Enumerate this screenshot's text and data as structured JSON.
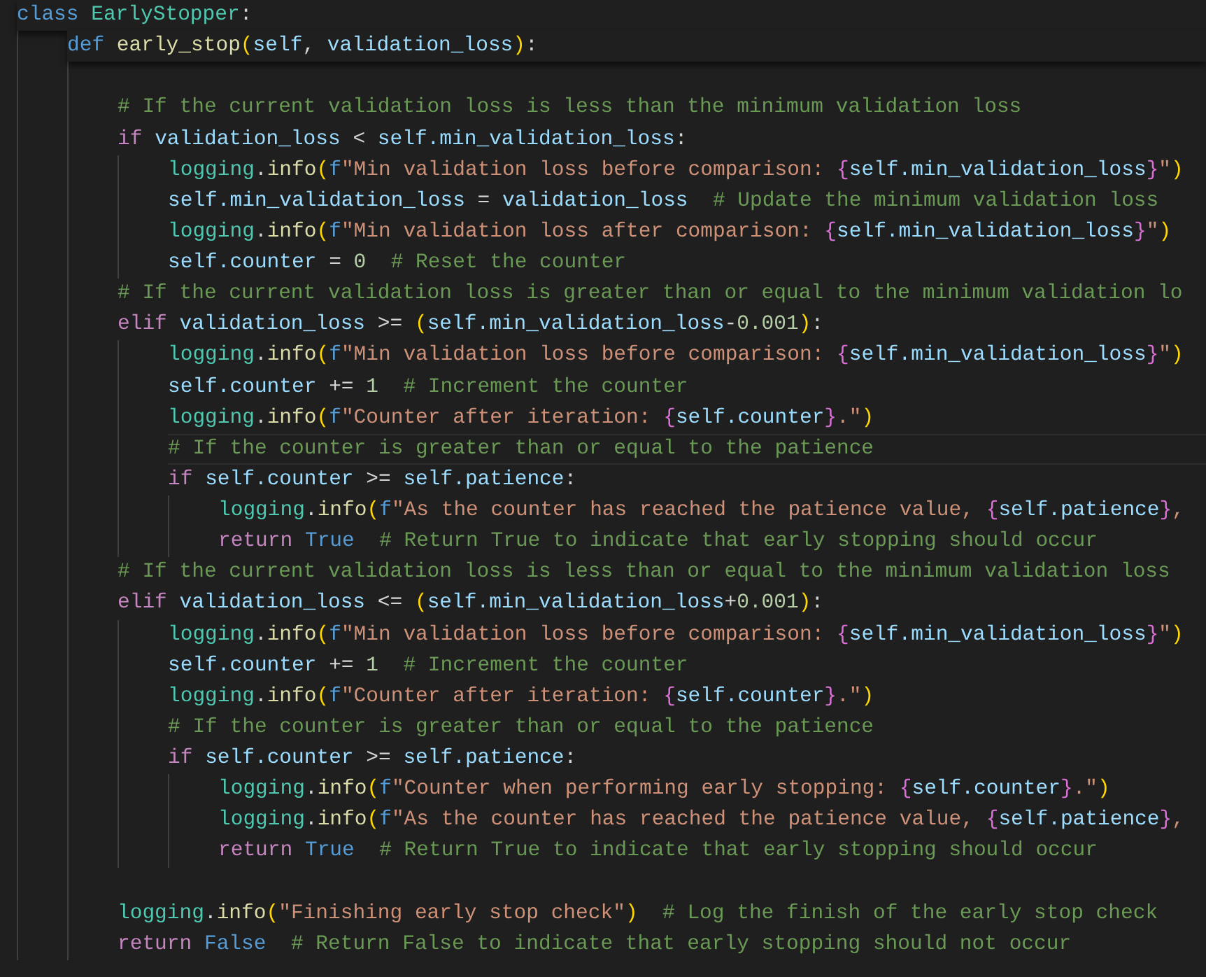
{
  "editor": {
    "lines": [
      {
        "kind": "code",
        "current": false,
        "sticky": true,
        "tokens": [
          {
            "text": "class ",
            "kind": "kw"
          },
          {
            "text": "EarlyStopper",
            "kind": "cls"
          },
          {
            "text": ":",
            "kind": "p"
          }
        ],
        "children": [
          {
            "kind": "code",
            "current": false,
            "sticky": true,
            "tokens": [
              {
                "text": "def ",
                "kind": "kw"
              },
              {
                "text": "early_stop",
                "kind": "fn"
              },
              {
                "text": "(",
                "kind": "b1"
              },
              {
                "text": "self",
                "kind": "var"
              },
              {
                "text": ", ",
                "kind": "p"
              },
              {
                "text": "validation_loss",
                "kind": "var"
              },
              {
                "text": ")",
                "kind": "b1"
              },
              {
                "text": ":",
                "kind": "p"
              }
            ],
            "children": [
              {
                "kind": "blank"
              },
              {
                "kind": "code",
                "current": false,
                "tokens": [
                  {
                    "text": "# If the current validation loss is less than the minimum validation loss",
                    "kind": "cm"
                  }
                ]
              },
              {
                "kind": "code",
                "current": false,
                "tokens": [
                  {
                    "text": "if ",
                    "kind": "ctl"
                  },
                  {
                    "text": "validation_loss",
                    "kind": "var"
                  },
                  {
                    "text": " < ",
                    "kind": "p"
                  },
                  {
                    "text": "self.min_validation_loss",
                    "kind": "var"
                  },
                  {
                    "text": ":",
                    "kind": "p"
                  }
                ],
                "children": [
                  {
                    "kind": "code",
                    "current": false,
                    "tokens": [
                      {
                        "text": "logging",
                        "kind": "cls"
                      },
                      {
                        "text": ".",
                        "kind": "p"
                      },
                      {
                        "text": "info",
                        "kind": "fn"
                      },
                      {
                        "text": "(",
                        "kind": "b1"
                      },
                      {
                        "text": "f",
                        "kind": "kw"
                      },
                      {
                        "text": "\"Min validation loss before comparison: ",
                        "kind": "str"
                      },
                      {
                        "text": "{",
                        "kind": "b2"
                      },
                      {
                        "text": "self.min_validation_loss",
                        "kind": "var"
                      },
                      {
                        "text": "}",
                        "kind": "b2"
                      },
                      {
                        "text": "\"",
                        "kind": "str"
                      },
                      {
                        "text": ")",
                        "kind": "b1"
                      }
                    ]
                  },
                  {
                    "kind": "code",
                    "current": false,
                    "tokens": [
                      {
                        "text": "self.min_validation_loss",
                        "kind": "var"
                      },
                      {
                        "text": " = ",
                        "kind": "p"
                      },
                      {
                        "text": "validation_loss  ",
                        "kind": "var"
                      },
                      {
                        "text": "# Update the minimum validation loss",
                        "kind": "cm"
                      }
                    ]
                  },
                  {
                    "kind": "code",
                    "current": false,
                    "tokens": [
                      {
                        "text": "logging",
                        "kind": "cls"
                      },
                      {
                        "text": ".",
                        "kind": "p"
                      },
                      {
                        "text": "info",
                        "kind": "fn"
                      },
                      {
                        "text": "(",
                        "kind": "b1"
                      },
                      {
                        "text": "f",
                        "kind": "kw"
                      },
                      {
                        "text": "\"Min validation loss after comparison: ",
                        "kind": "str"
                      },
                      {
                        "text": "{",
                        "kind": "b2"
                      },
                      {
                        "text": "self.min_validation_loss",
                        "kind": "var"
                      },
                      {
                        "text": "}",
                        "kind": "b2"
                      },
                      {
                        "text": "\"",
                        "kind": "str"
                      },
                      {
                        "text": ")",
                        "kind": "b1"
                      }
                    ]
                  },
                  {
                    "kind": "code",
                    "current": false,
                    "tokens": [
                      {
                        "text": "self.counter",
                        "kind": "var"
                      },
                      {
                        "text": " = ",
                        "kind": "p"
                      },
                      {
                        "text": "0  ",
                        "kind": "num"
                      },
                      {
                        "text": "# Reset the counter",
                        "kind": "cm"
                      }
                    ]
                  }
                ]
              },
              {
                "kind": "code",
                "current": false,
                "tokens": [
                  {
                    "text": "# If the current validation loss is greater than or equal to the minimum validation lo",
                    "kind": "cm"
                  }
                ]
              },
              {
                "kind": "code",
                "current": false,
                "tokens": [
                  {
                    "text": "elif ",
                    "kind": "ctl"
                  },
                  {
                    "text": "validation_loss",
                    "kind": "var"
                  },
                  {
                    "text": " >= ",
                    "kind": "p"
                  },
                  {
                    "text": "(",
                    "kind": "b1"
                  },
                  {
                    "text": "self.min_validation_loss",
                    "kind": "var"
                  },
                  {
                    "text": "-",
                    "kind": "p"
                  },
                  {
                    "text": "0.001",
                    "kind": "num"
                  },
                  {
                    "text": ")",
                    "kind": "b1"
                  },
                  {
                    "text": ":",
                    "kind": "p"
                  }
                ],
                "children": [
                  {
                    "kind": "code",
                    "current": false,
                    "tokens": [
                      {
                        "text": "logging",
                        "kind": "cls"
                      },
                      {
                        "text": ".",
                        "kind": "p"
                      },
                      {
                        "text": "info",
                        "kind": "fn"
                      },
                      {
                        "text": "(",
                        "kind": "b1"
                      },
                      {
                        "text": "f",
                        "kind": "kw"
                      },
                      {
                        "text": "\"Min validation loss before comparison: ",
                        "kind": "str"
                      },
                      {
                        "text": "{",
                        "kind": "b2"
                      },
                      {
                        "text": "self.min_validation_loss",
                        "kind": "var"
                      },
                      {
                        "text": "}",
                        "kind": "b2"
                      },
                      {
                        "text": "\"",
                        "kind": "str"
                      },
                      {
                        "text": ")",
                        "kind": "b1"
                      }
                    ]
                  },
                  {
                    "kind": "code",
                    "current": false,
                    "tokens": [
                      {
                        "text": "self.counter",
                        "kind": "var"
                      },
                      {
                        "text": " += ",
                        "kind": "p"
                      },
                      {
                        "text": "1  ",
                        "kind": "num"
                      },
                      {
                        "text": "# Increment the counter",
                        "kind": "cm"
                      }
                    ]
                  },
                  {
                    "kind": "code",
                    "current": false,
                    "tokens": [
                      {
                        "text": "logging",
                        "kind": "cls"
                      },
                      {
                        "text": ".",
                        "kind": "p"
                      },
                      {
                        "text": "info",
                        "kind": "fn"
                      },
                      {
                        "text": "(",
                        "kind": "b1"
                      },
                      {
                        "text": "f",
                        "kind": "kw"
                      },
                      {
                        "text": "\"Counter after iteration: ",
                        "kind": "str"
                      },
                      {
                        "text": "{",
                        "kind": "b2"
                      },
                      {
                        "text": "self.counter",
                        "kind": "var"
                      },
                      {
                        "text": "}",
                        "kind": "b2"
                      },
                      {
                        "text": ".\"",
                        "kind": "str"
                      },
                      {
                        "text": ")",
                        "kind": "b1"
                      }
                    ]
                  },
                  {
                    "kind": "code",
                    "current": true,
                    "tokens": [
                      {
                        "text": "# If the counter is greater than or equal to the patience",
                        "kind": "cm"
                      }
                    ]
                  },
                  {
                    "kind": "code",
                    "current": false,
                    "tokens": [
                      {
                        "text": "if ",
                        "kind": "ctl"
                      },
                      {
                        "text": "self.counter",
                        "kind": "var"
                      },
                      {
                        "text": " >= ",
                        "kind": "p"
                      },
                      {
                        "text": "self.patience",
                        "kind": "var"
                      },
                      {
                        "text": ":",
                        "kind": "p"
                      }
                    ],
                    "children": [
                      {
                        "kind": "code",
                        "current": false,
                        "tokens": [
                          {
                            "text": "logging",
                            "kind": "cls"
                          },
                          {
                            "text": ".",
                            "kind": "p"
                          },
                          {
                            "text": "info",
                            "kind": "fn"
                          },
                          {
                            "text": "(",
                            "kind": "b1"
                          },
                          {
                            "text": "f",
                            "kind": "kw"
                          },
                          {
                            "text": "\"As the counter has reached the patience value, ",
                            "kind": "str"
                          },
                          {
                            "text": "{",
                            "kind": "b2"
                          },
                          {
                            "text": "self.patience",
                            "kind": "var"
                          },
                          {
                            "text": "}",
                            "kind": "b2"
                          },
                          {
                            "text": ",",
                            "kind": "str"
                          }
                        ]
                      },
                      {
                        "kind": "code",
                        "current": false,
                        "tokens": [
                          {
                            "text": "return ",
                            "kind": "ctl"
                          },
                          {
                            "text": "True  ",
                            "kind": "kw"
                          },
                          {
                            "text": "# Return True to indicate that early stopping should occur",
                            "kind": "cm"
                          }
                        ]
                      }
                    ]
                  }
                ]
              },
              {
                "kind": "code",
                "current": false,
                "tokens": [
                  {
                    "text": "# If the current validation loss is less than or equal to the minimum validation loss",
                    "kind": "cm"
                  }
                ]
              },
              {
                "kind": "code",
                "current": false,
                "tokens": [
                  {
                    "text": "elif ",
                    "kind": "ctl"
                  },
                  {
                    "text": "validation_loss",
                    "kind": "var"
                  },
                  {
                    "text": " <= ",
                    "kind": "p"
                  },
                  {
                    "text": "(",
                    "kind": "b1"
                  },
                  {
                    "text": "self.min_validation_loss",
                    "kind": "var"
                  },
                  {
                    "text": "+",
                    "kind": "p"
                  },
                  {
                    "text": "0.001",
                    "kind": "num"
                  },
                  {
                    "text": ")",
                    "kind": "b1"
                  },
                  {
                    "text": ":",
                    "kind": "p"
                  }
                ],
                "children": [
                  {
                    "kind": "code",
                    "current": false,
                    "tokens": [
                      {
                        "text": "logging",
                        "kind": "cls"
                      },
                      {
                        "text": ".",
                        "kind": "p"
                      },
                      {
                        "text": "info",
                        "kind": "fn"
                      },
                      {
                        "text": "(",
                        "kind": "b1"
                      },
                      {
                        "text": "f",
                        "kind": "kw"
                      },
                      {
                        "text": "\"Min validation loss before comparison: ",
                        "kind": "str"
                      },
                      {
                        "text": "{",
                        "kind": "b2"
                      },
                      {
                        "text": "self.min_validation_loss",
                        "kind": "var"
                      },
                      {
                        "text": "}",
                        "kind": "b2"
                      },
                      {
                        "text": "\"",
                        "kind": "str"
                      },
                      {
                        "text": ")",
                        "kind": "b1"
                      }
                    ]
                  },
                  {
                    "kind": "code",
                    "current": false,
                    "tokens": [
                      {
                        "text": "self.counter",
                        "kind": "var"
                      },
                      {
                        "text": " += ",
                        "kind": "p"
                      },
                      {
                        "text": "1  ",
                        "kind": "num"
                      },
                      {
                        "text": "# Increment the counter",
                        "kind": "cm"
                      }
                    ]
                  },
                  {
                    "kind": "code",
                    "current": false,
                    "tokens": [
                      {
                        "text": "logging",
                        "kind": "cls"
                      },
                      {
                        "text": ".",
                        "kind": "p"
                      },
                      {
                        "text": "info",
                        "kind": "fn"
                      },
                      {
                        "text": "(",
                        "kind": "b1"
                      },
                      {
                        "text": "f",
                        "kind": "kw"
                      },
                      {
                        "text": "\"Counter after iteration: ",
                        "kind": "str"
                      },
                      {
                        "text": "{",
                        "kind": "b2"
                      },
                      {
                        "text": "self.counter",
                        "kind": "var"
                      },
                      {
                        "text": "}",
                        "kind": "b2"
                      },
                      {
                        "text": ".\"",
                        "kind": "str"
                      },
                      {
                        "text": ")",
                        "kind": "b1"
                      }
                    ]
                  },
                  {
                    "kind": "code",
                    "current": false,
                    "tokens": [
                      {
                        "text": "# If the counter is greater than or equal to the patience",
                        "kind": "cm"
                      }
                    ]
                  },
                  {
                    "kind": "code",
                    "current": false,
                    "tokens": [
                      {
                        "text": "if ",
                        "kind": "ctl"
                      },
                      {
                        "text": "self.counter",
                        "kind": "var"
                      },
                      {
                        "text": " >= ",
                        "kind": "p"
                      },
                      {
                        "text": "self.patience",
                        "kind": "var"
                      },
                      {
                        "text": ":",
                        "kind": "p"
                      }
                    ],
                    "children": [
                      {
                        "kind": "code",
                        "current": false,
                        "tokens": [
                          {
                            "text": "logging",
                            "kind": "cls"
                          },
                          {
                            "text": ".",
                            "kind": "p"
                          },
                          {
                            "text": "info",
                            "kind": "fn"
                          },
                          {
                            "text": "(",
                            "kind": "b1"
                          },
                          {
                            "text": "f",
                            "kind": "kw"
                          },
                          {
                            "text": "\"Counter when performing early stopping: ",
                            "kind": "str"
                          },
                          {
                            "text": "{",
                            "kind": "b2"
                          },
                          {
                            "text": "self.counter",
                            "kind": "var"
                          },
                          {
                            "text": "}",
                            "kind": "b2"
                          },
                          {
                            "text": ".\"",
                            "kind": "str"
                          },
                          {
                            "text": ")",
                            "kind": "b1"
                          }
                        ]
                      },
                      {
                        "kind": "code",
                        "current": false,
                        "tokens": [
                          {
                            "text": "logging",
                            "kind": "cls"
                          },
                          {
                            "text": ".",
                            "kind": "p"
                          },
                          {
                            "text": "info",
                            "kind": "fn"
                          },
                          {
                            "text": "(",
                            "kind": "b1"
                          },
                          {
                            "text": "f",
                            "kind": "kw"
                          },
                          {
                            "text": "\"As the counter has reached the patience value, ",
                            "kind": "str"
                          },
                          {
                            "text": "{",
                            "kind": "b2"
                          },
                          {
                            "text": "self.patience",
                            "kind": "var"
                          },
                          {
                            "text": "}",
                            "kind": "b2"
                          },
                          {
                            "text": ",",
                            "kind": "str"
                          }
                        ]
                      },
                      {
                        "kind": "code",
                        "current": false,
                        "tokens": [
                          {
                            "text": "return ",
                            "kind": "ctl"
                          },
                          {
                            "text": "True  ",
                            "kind": "kw"
                          },
                          {
                            "text": "# Return True to indicate that early stopping should occur",
                            "kind": "cm"
                          }
                        ]
                      }
                    ]
                  }
                ]
              },
              {
                "kind": "blank"
              },
              {
                "kind": "code",
                "current": false,
                "tokens": [
                  {
                    "text": "logging",
                    "kind": "cls"
                  },
                  {
                    "text": ".",
                    "kind": "p"
                  },
                  {
                    "text": "info",
                    "kind": "fn"
                  },
                  {
                    "text": "(",
                    "kind": "b1"
                  },
                  {
                    "text": "\"Finishing early stop check\"",
                    "kind": "str"
                  },
                  {
                    "text": ")  ",
                    "kind": "b1"
                  },
                  {
                    "text": "# Log the finish of the early stop check",
                    "kind": "cm"
                  }
                ]
              },
              {
                "kind": "code",
                "current": false,
                "tokens": [
                  {
                    "text": "return ",
                    "kind": "ctl"
                  },
                  {
                    "text": "False  ",
                    "kind": "kw"
                  },
                  {
                    "text": "# Return False to indicate that early stopping should not occur",
                    "kind": "cm"
                  }
                ]
              }
            ]
          }
        ]
      }
    ]
  }
}
